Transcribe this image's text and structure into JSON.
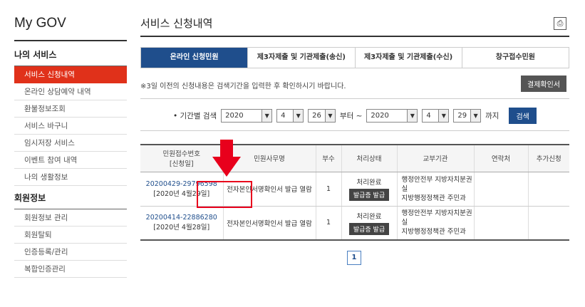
{
  "brand": "My GOV",
  "sidebar": {
    "section1": "나의 서비스",
    "items1": [
      "서비스 신청내역",
      "온라인 상담예약 내역",
      "환불정보조회",
      "서비스 바구니",
      "임시저장 서비스",
      "이벤트 참여 내역",
      "나의 생활정보"
    ],
    "section2": "회원정보",
    "items2": [
      "회원정보 관리",
      "회원탈퇴",
      "인증등록/관리",
      "복합인증관리"
    ]
  },
  "header": {
    "title": "서비스 신청내역"
  },
  "tabs": [
    "온라인 신청민원",
    "제3자제출 및 기관제출(송신)",
    "제3자제출 및 기관제출(수신)",
    "창구접수민원"
  ],
  "notice": "※3일 이전의 신청내용은 검색기간을 입력한 후 확인하시기 바랍니다.",
  "pay_button": "결제확인서",
  "search": {
    "label": "• 기간별 검색",
    "from": {
      "year": "2020",
      "month": "4",
      "day": "26"
    },
    "sep": "부터 ~",
    "to": {
      "year": "2020",
      "month": "4",
      "day": "29"
    },
    "until": "까지",
    "button": "검색"
  },
  "table": {
    "headers": [
      "민원접수번호\n[신청일]",
      "민원사무명",
      "부수",
      "처리상태",
      "교부기관",
      "연락처",
      "추가신청"
    ],
    "rows": [
      {
        "id": "20200429-29796598",
        "date": "[2020년 4월29일]",
        "name": "전자본인서명확인서 발급 열람",
        "count": "1",
        "status": "처리완료",
        "action": "발급증 발급",
        "org1": "행정안전부 지방자치분권실",
        "org2": "지방행정정책관 주민과"
      },
      {
        "id": "20200414-22886280",
        "date": "[2020년 4월28일]",
        "name": "전자본인서명확인서 발급 열람",
        "count": "1",
        "status": "처리완료",
        "action": "발급증 발급",
        "org1": "행정안전부 지방자치분권실",
        "org2": "지방행정정책관 주민과"
      }
    ]
  },
  "pager": {
    "current": "1"
  },
  "colors": {
    "accent": "#e0311a",
    "primary": "#1f4e8c",
    "highlight": "#e8001c"
  }
}
